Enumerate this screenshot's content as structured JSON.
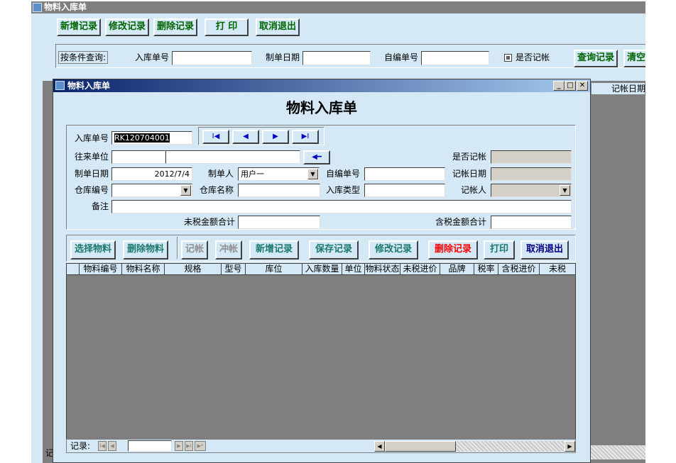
{
  "outer_window": {
    "title": "物料入库单",
    "toolbar": {
      "new_label": "新增记录",
      "edit_label": "修改记录",
      "delete_label": "删除记录",
      "print_label": "打 印",
      "cancel_label": "取消退出"
    },
    "query": {
      "group_label": "按条件查询:",
      "doc_no_label": "入库单号",
      "date_label": "制单日期",
      "own_no_label": "自编单号",
      "posted_label": "是否记帐",
      "search_label": "查询记录",
      "clear_label": "清空"
    },
    "grid_header_visible": "记帐日期",
    "bottom_fragment": "记"
  },
  "dialog": {
    "title": "物料入库单",
    "heading": "物料入库单",
    "fields": {
      "doc_no_label": "入库单号",
      "doc_no_value": "RK120704001",
      "partner_label": "往来单位",
      "posted_label": "是否记帐",
      "date_label": "制单日期",
      "date_value": "2012/7/4",
      "maker_label": "制单人",
      "maker_value": "用户一",
      "own_no_label": "自编单号",
      "post_date_label": "记帐日期",
      "wh_code_label": "仓库编号",
      "wh_name_label": "仓库名称",
      "type_label": "入库类型",
      "poster_label": "记帐人",
      "remark_label": "备注",
      "untaxed_total_label": "未税金额合计",
      "taxed_total_label": "含税金额合计"
    },
    "nav": {
      "first": "I◀",
      "prev": "◀",
      "next": "▶",
      "last": "▶I"
    },
    "actions": {
      "select_material": "选择物料",
      "delete_material": "删除物料",
      "post": "记帐",
      "reverse": "冲帐",
      "new_record": "新增记录",
      "save_record": "保存记录",
      "edit_record": "修改记录",
      "delete_record": "删除记录",
      "print": "打印",
      "cancel_exit": "取消退出"
    },
    "grid": {
      "columns": [
        "物料编号",
        "物料名称",
        "规格",
        "型号",
        "库位",
        "入库数量",
        "单位",
        "物料状态",
        "未税进价",
        "品牌",
        "税率",
        "含税进价",
        "未税"
      ]
    },
    "record_nav": {
      "label": "记录:"
    }
  },
  "colors": {
    "window_bg": "#d4e8f5",
    "toolbar_text": "#006400",
    "action_text": "#1a7a6a",
    "danger_text": "#ff0000",
    "navy_text": "#000080",
    "grid_bg": "#7f7f7f"
  }
}
